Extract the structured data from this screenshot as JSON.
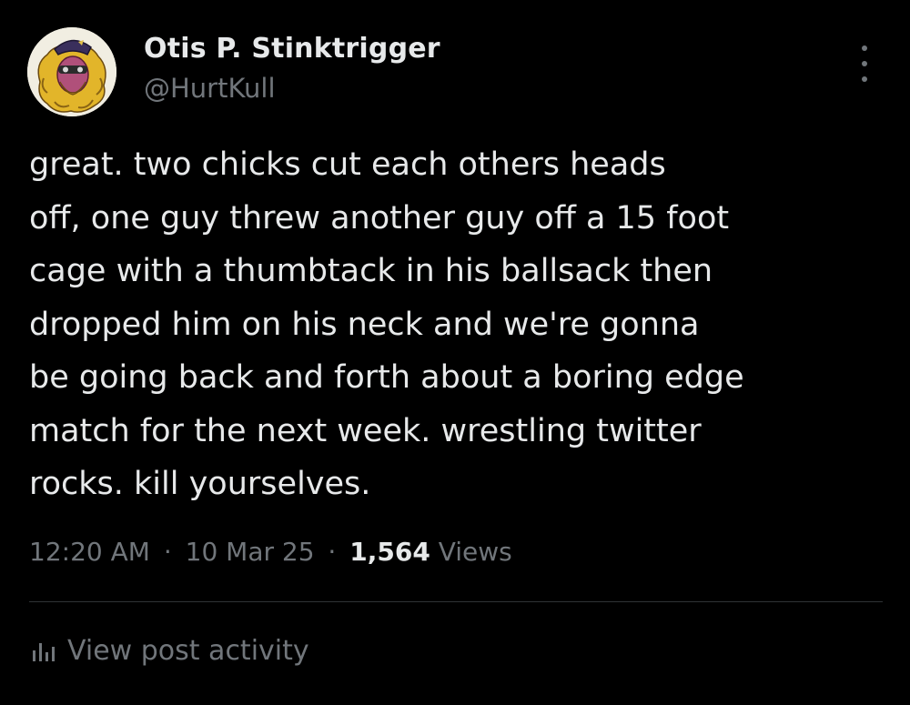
{
  "author": {
    "display_name": "Otis P. Stinktrigger",
    "handle": "@HurtKull",
    "avatar_icon": "cartoon-avatar"
  },
  "post": {
    "text_lines": [
      "great. two chicks cut each others heads",
      "off, one guy threw another guy off a 15 foot",
      "cage with a thumbtack in his ballsack then",
      "dropped him on his neck and we're gonna",
      "be going back and forth about a boring edge",
      "match for the next week. wrestling twitter",
      "rocks. kill yourselves."
    ]
  },
  "meta": {
    "time": "12:20 AM",
    "separator": "·",
    "date": "10 Mar 25",
    "views_count": "1,564",
    "views_label": "Views"
  },
  "activity": {
    "icon": "bar-chart-icon",
    "label": "View post activity"
  },
  "colors": {
    "background": "#000000",
    "primary_text": "#e7e9ea",
    "secondary_text": "#71767b",
    "divider": "#2f3336"
  }
}
